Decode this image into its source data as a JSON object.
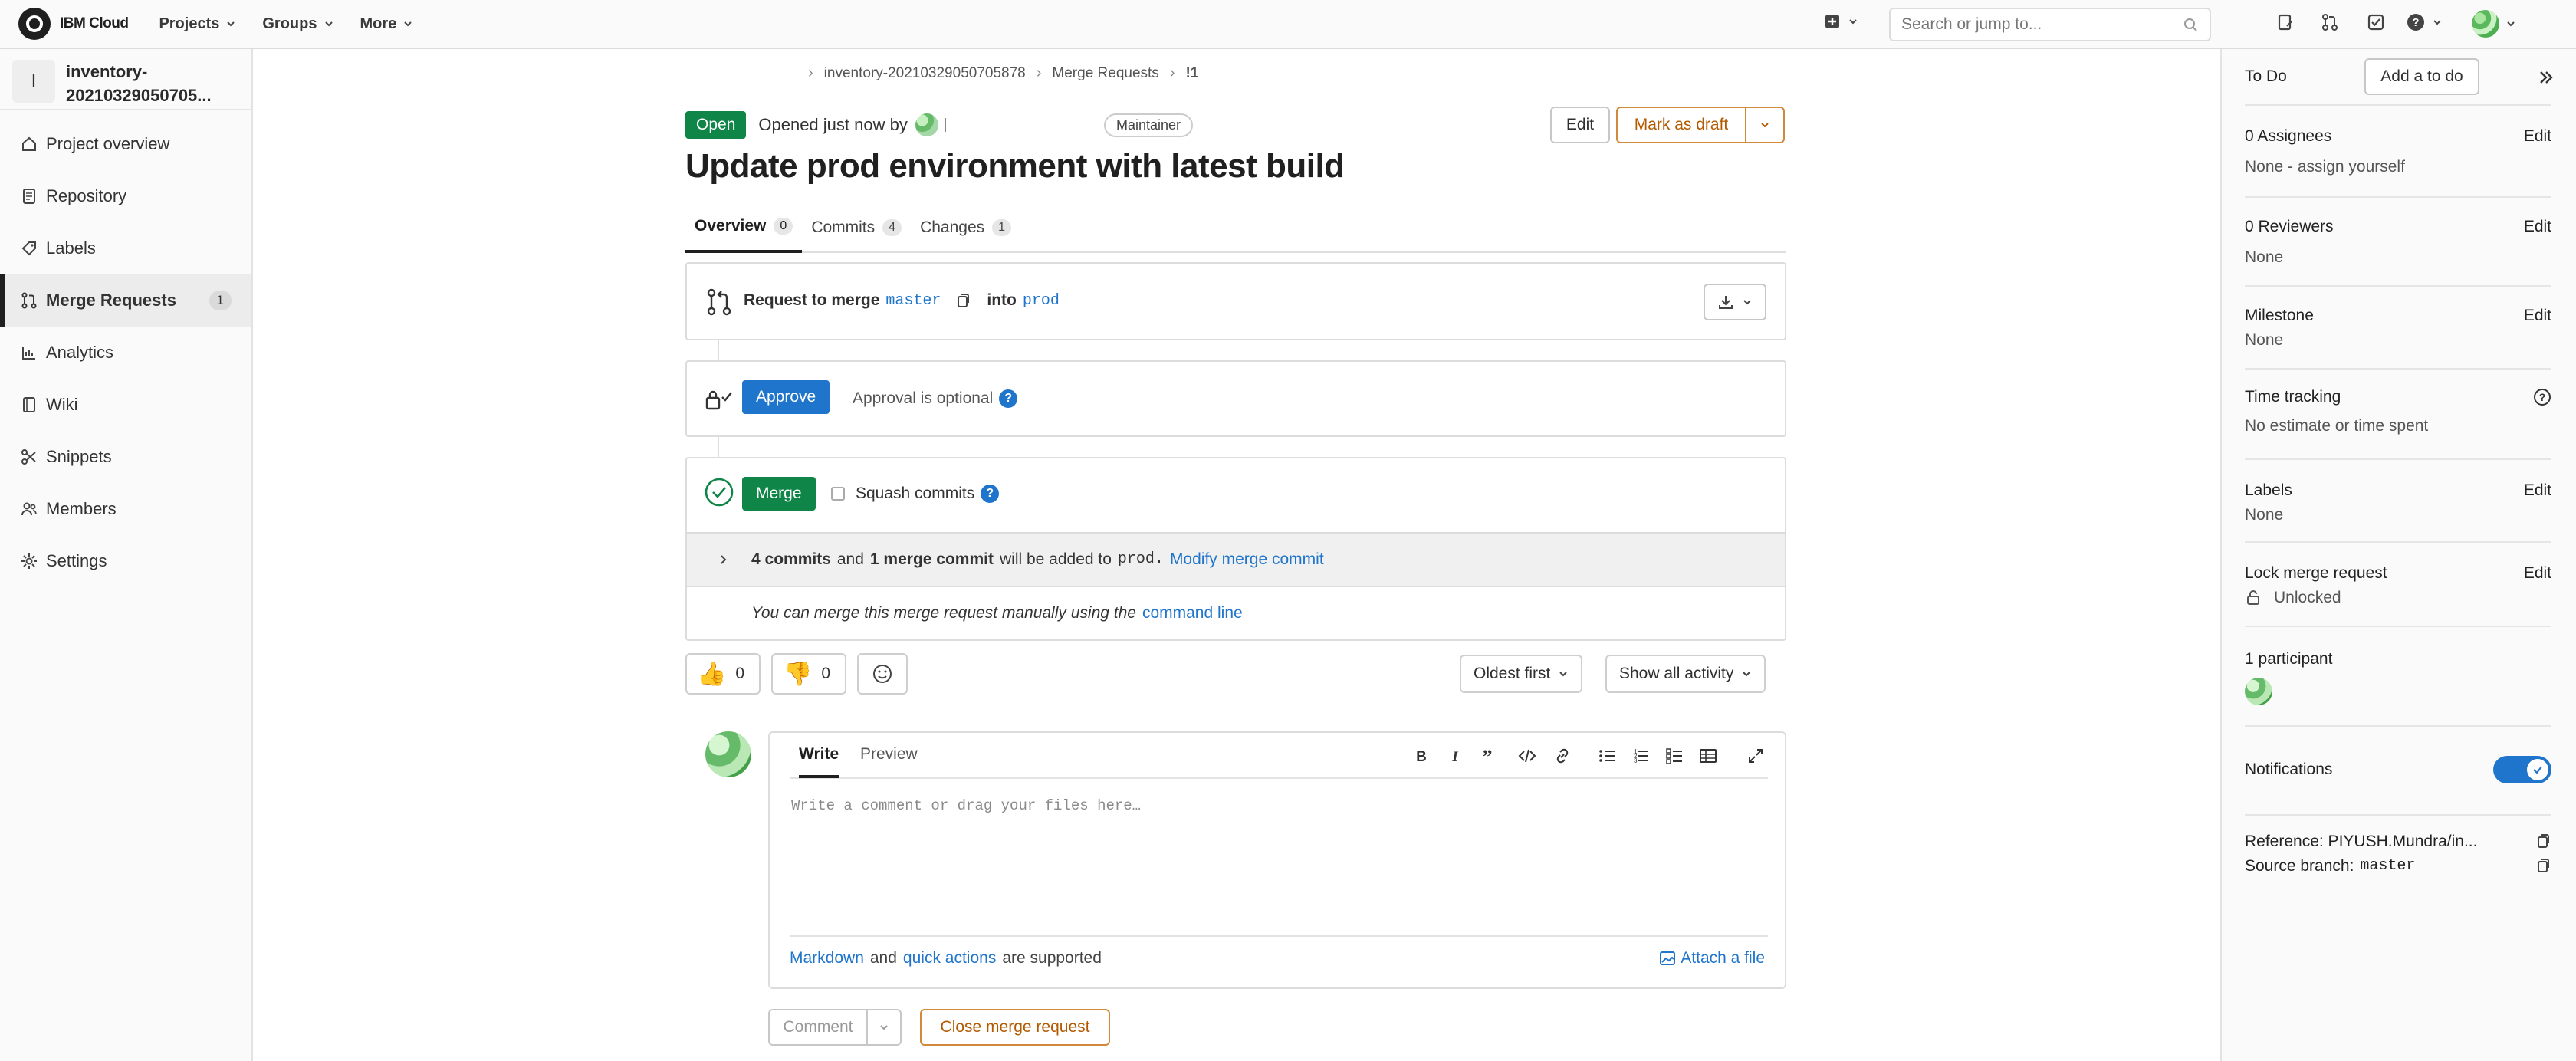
{
  "topbar": {
    "brand": "IBM Cloud",
    "nav": [
      {
        "label": "Projects"
      },
      {
        "label": "Groups"
      },
      {
        "label": "More"
      }
    ],
    "search_placeholder": "Search or jump to..."
  },
  "sidebar": {
    "project_initial": "I",
    "project_name": "inventory-20210329050705...",
    "items": [
      {
        "label": "Project overview",
        "icon": "home-icon"
      },
      {
        "label": "Repository",
        "icon": "doc-icon"
      },
      {
        "label": "Labels",
        "icon": "label-icon"
      },
      {
        "label": "Merge Requests",
        "icon": "merge-request-icon",
        "badge": "1"
      },
      {
        "label": "Analytics",
        "icon": "chart-icon"
      },
      {
        "label": "Wiki",
        "icon": "book-icon"
      },
      {
        "label": "Snippets",
        "icon": "scissors-icon"
      },
      {
        "label": "Members",
        "icon": "users-icon"
      },
      {
        "label": "Settings",
        "icon": "gear-icon"
      }
    ]
  },
  "breadcrumb": [
    "inventory-20210329050705878",
    "Merge Requests",
    "!1"
  ],
  "mr": {
    "status": "Open",
    "opened_text": "Opened just now by",
    "role": "Maintainer",
    "edit_label": "Edit",
    "draft_label": "Mark as draft",
    "title": "Update prod environment with latest build",
    "tabs": [
      {
        "label": "Overview",
        "count": "0"
      },
      {
        "label": "Commits",
        "count": "4"
      },
      {
        "label": "Changes",
        "count": "1"
      }
    ]
  },
  "merge_widget": {
    "request_text": "Request to merge",
    "source_branch": "master",
    "into_text": "into",
    "target_branch": "prod",
    "approve_label": "Approve",
    "approval_text": "Approval is optional",
    "merge_label": "Merge",
    "squash_label": "Squash commits",
    "commits_count": "4 commits",
    "and_text": "and",
    "merge_commit": "1 merge commit",
    "added_text": "will be added to",
    "added_branch": "prod.",
    "modify_link": "Modify merge commit",
    "manual_text": "You can merge this merge request manually using the",
    "command_line": "command line"
  },
  "reactions": {
    "thumbs_up": "0",
    "thumbs_down": "0",
    "sort_label": "Oldest first",
    "filter_label": "Show all activity"
  },
  "editor": {
    "write_tab": "Write",
    "preview_tab": "Preview",
    "placeholder": "Write a comment or drag your files here…",
    "markdown_link": "Markdown",
    "and_text": "and",
    "quick_actions": "quick actions",
    "supported_text": "are supported",
    "attach_label": "Attach a file",
    "comment_label": "Comment",
    "close_label": "Close merge request"
  },
  "right_sidebar": {
    "todo_label": "To Do",
    "add_todo": "Add a to do",
    "assignees_label": "0 Assignees",
    "assignees_value": "None - assign yourself",
    "reviewers_label": "0 Reviewers",
    "reviewers_value": "None",
    "milestone_label": "Milestone",
    "milestone_value": "None",
    "time_label": "Time tracking",
    "time_value": "No estimate or time spent",
    "labels_label": "Labels",
    "labels_value": "None",
    "lock_label": "Lock merge request",
    "lock_value": "Unlocked",
    "participants_label": "1 participant",
    "notifications_label": "Notifications",
    "reference_text": "Reference: PIYUSH.Mundra/in...",
    "source_branch_label": "Source branch:",
    "source_branch_value": "master",
    "edit_label": "Edit"
  },
  "colors": {
    "open_green": "#108548",
    "link_blue": "#1f75cb",
    "warning_orange": "#b35a00"
  }
}
